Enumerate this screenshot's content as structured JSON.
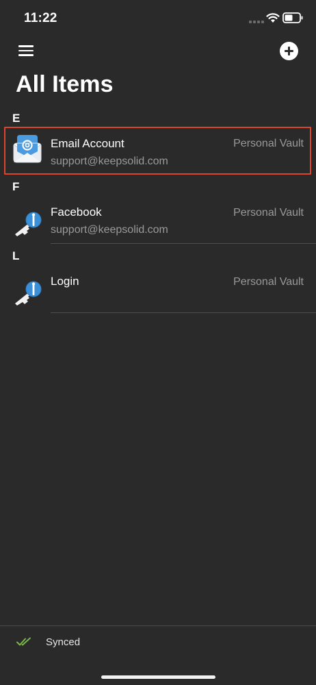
{
  "status_bar": {
    "time": "11:22"
  },
  "nav": {
    "menu_icon": "hamburger-icon",
    "add_icon": "plus-circle-icon"
  },
  "page": {
    "title": "All Items"
  },
  "sections": [
    {
      "letter": "E",
      "items": [
        {
          "icon": "email-envelope-icon",
          "title": "Email Account",
          "subtitle": "support@keepsolid.com",
          "vault": "Personal Vault",
          "highlighted": true
        }
      ]
    },
    {
      "letter": "F",
      "items": [
        {
          "icon": "key-icon",
          "title": "Facebook",
          "subtitle": "support@keepsolid.com",
          "vault": "Personal Vault"
        }
      ]
    },
    {
      "letter": "L",
      "items": [
        {
          "icon": "key-icon",
          "title": "Login",
          "subtitle": "",
          "vault": "Personal Vault"
        }
      ]
    }
  ],
  "footer": {
    "sync_icon": "double-check-icon",
    "sync_label": "Synced"
  },
  "colors": {
    "background": "#2a2a2a",
    "highlight": "#e0452c",
    "sync_check": "#7ab648",
    "key_blue": "#3b8fd6"
  }
}
